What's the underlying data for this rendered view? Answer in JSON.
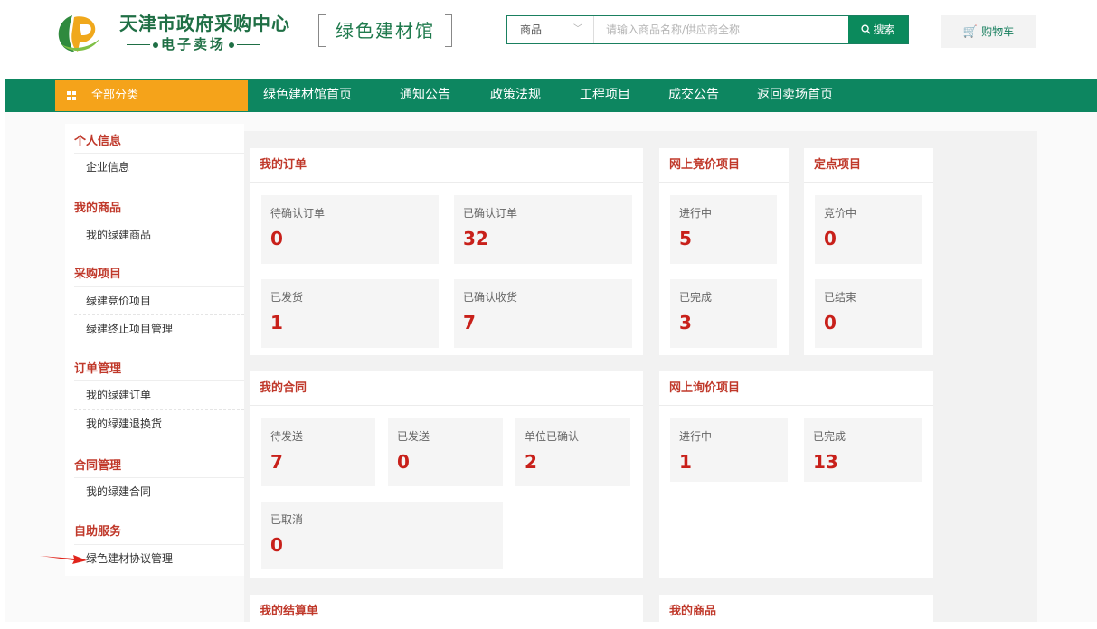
{
  "brand": {
    "title": "天津市政府采购中心",
    "subtitle": "电子卖场",
    "venue": "绿色建材馆",
    "colors": {
      "green": "#0d8660",
      "orange": "#f5a31a",
      "red": "#c8201a"
    }
  },
  "search": {
    "category": "商品",
    "placeholder": "请输入商品名称/供应商全称",
    "button": "搜索",
    "button_icon": "search-icon"
  },
  "cart": {
    "label": "购物车",
    "icon": "cart-icon"
  },
  "nav": {
    "all_categories": "全部分类",
    "items": [
      "绿色建材馆首页",
      "通知公告",
      "政策法规",
      "工程项目",
      "成交公告",
      "返回卖场首页"
    ]
  },
  "sidebar": {
    "groups": [
      {
        "title": "个人信息",
        "items": [
          "企业信息"
        ]
      },
      {
        "title": "我的商品",
        "items": [
          "我的绿建商品"
        ]
      },
      {
        "title": "采购项目",
        "items": [
          "绿建竞价项目",
          "绿建终止项目管理"
        ]
      },
      {
        "title": "订单管理",
        "items": [
          "我的绿建订单",
          "我的绿建退换货"
        ]
      },
      {
        "title": "合同管理",
        "items": [
          "我的绿建合同"
        ]
      },
      {
        "title": "自助服务",
        "items": [
          "绿色建材协议管理"
        ]
      }
    ]
  },
  "panels": {
    "orders": {
      "title": "我的订单",
      "tiles": [
        {
          "label": "待确认订单",
          "value": "0"
        },
        {
          "label": "已确认订单",
          "value": "32"
        },
        {
          "label": "已发货",
          "value": "1"
        },
        {
          "label": "已确认收货",
          "value": "7"
        }
      ]
    },
    "bidding": {
      "title": "网上竞价项目",
      "tiles": [
        {
          "label": "进行中",
          "value": "5"
        },
        {
          "label": "已完成",
          "value": "3"
        }
      ]
    },
    "fixed": {
      "title": "定点项目",
      "tiles": [
        {
          "label": "竞价中",
          "value": "0"
        },
        {
          "label": "已结束",
          "value": "0"
        }
      ]
    },
    "contracts": {
      "title": "我的合同",
      "tiles": [
        {
          "label": "待发送",
          "value": "7"
        },
        {
          "label": "已发送",
          "value": "0"
        },
        {
          "label": "单位已确认",
          "value": "2"
        },
        {
          "label": "已取消",
          "value": "0"
        }
      ]
    },
    "inquiry": {
      "title": "网上询价项目",
      "tiles": [
        {
          "label": "进行中",
          "value": "1"
        },
        {
          "label": "已完成",
          "value": "13"
        }
      ]
    },
    "settlement": {
      "title": "我的结算单"
    },
    "products": {
      "title": "我的商品"
    }
  }
}
